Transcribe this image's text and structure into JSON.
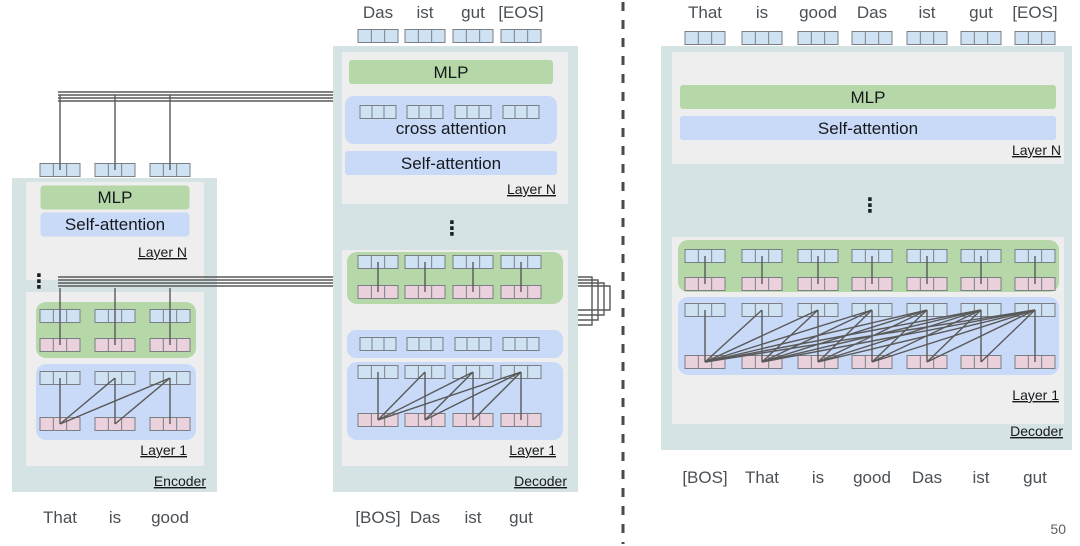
{
  "figure": {
    "page_number": "50",
    "divider": "vertical-dashed-line"
  },
  "palette": {
    "outer_panel": "#d5e3e4",
    "layer_panel": "#eeeeee",
    "mlp_green": "#b6d7a8",
    "attn_blue": "#c9daf8",
    "cell_blue": "#cfe2f3",
    "cell_pink": "#ead1dc",
    "line": "#595959",
    "text": "#16191c"
  },
  "left_panel": {
    "encoder": {
      "name_label": "Encoder",
      "input_tokens": [
        "That",
        "is",
        "good"
      ],
      "layer_n": {
        "label": "Layer N",
        "blocks": [
          {
            "id": "mlp",
            "label": "MLP",
            "color": "#b6d7a8"
          },
          {
            "id": "self-attention",
            "label": "Self-attention",
            "color": "#c9daf8"
          }
        ]
      },
      "vertical_ellipsis": "⋮",
      "layer_1": {
        "label": "Layer 1",
        "blocks": [
          {
            "id": "mlp",
            "label": "MLP",
            "color": "#b6d7a8"
          },
          {
            "id": "self-attention",
            "label": "Self-attention",
            "color": "#c9daf8"
          }
        ],
        "attention_type": "bidirectional",
        "n_tokens": 3
      }
    },
    "decoder": {
      "name_label": "Decoder",
      "output_tokens": [
        "Das",
        "ist",
        "gut",
        "[EOS]"
      ],
      "input_tokens": [
        "[BOS]",
        "Das",
        "ist",
        "gut"
      ],
      "layer_n": {
        "label": "Layer N",
        "blocks": [
          {
            "id": "mlp",
            "label": "MLP",
            "color": "#b6d7a8"
          },
          {
            "id": "cross-attention",
            "label": "cross attention",
            "color": "#c9daf8"
          },
          {
            "id": "self-attention",
            "label": "Self-attention",
            "color": "#c9daf8"
          }
        ]
      },
      "vertical_ellipsis": "⋮",
      "layer_1": {
        "label": "Layer 1",
        "blocks": [
          {
            "id": "mlp",
            "label": "MLP",
            "color": "#b6d7a8"
          },
          {
            "id": "cross-attention",
            "label": "cross attention",
            "color": "#c9daf8"
          },
          {
            "id": "self-attention",
            "label": "Self-attention",
            "color": "#c9daf8"
          }
        ],
        "attention_type": "causal",
        "n_tokens": 4
      }
    }
  },
  "right_panel": {
    "decoder": {
      "name_label": "Decoder",
      "output_tokens": [
        "That",
        "is",
        "good",
        "Das",
        "ist",
        "gut",
        "[EOS]"
      ],
      "input_tokens": [
        "[BOS]",
        "That",
        "is",
        "good",
        "Das",
        "ist",
        "gut"
      ],
      "layer_n": {
        "label": "Layer N",
        "blocks": [
          {
            "id": "mlp",
            "label": "MLP",
            "color": "#b6d7a8"
          },
          {
            "id": "self-attention",
            "label": "Self-attention",
            "color": "#c9daf8"
          }
        ]
      },
      "vertical_ellipsis": "⋮",
      "layer_1": {
        "label": "Layer 1",
        "blocks": [
          {
            "id": "mlp",
            "label": "MLP",
            "color": "#b6d7a8"
          },
          {
            "id": "self-attention",
            "label": "Self-attention",
            "color": "#c9daf8"
          }
        ],
        "attention_type": "causal",
        "n_tokens": 7
      }
    }
  }
}
